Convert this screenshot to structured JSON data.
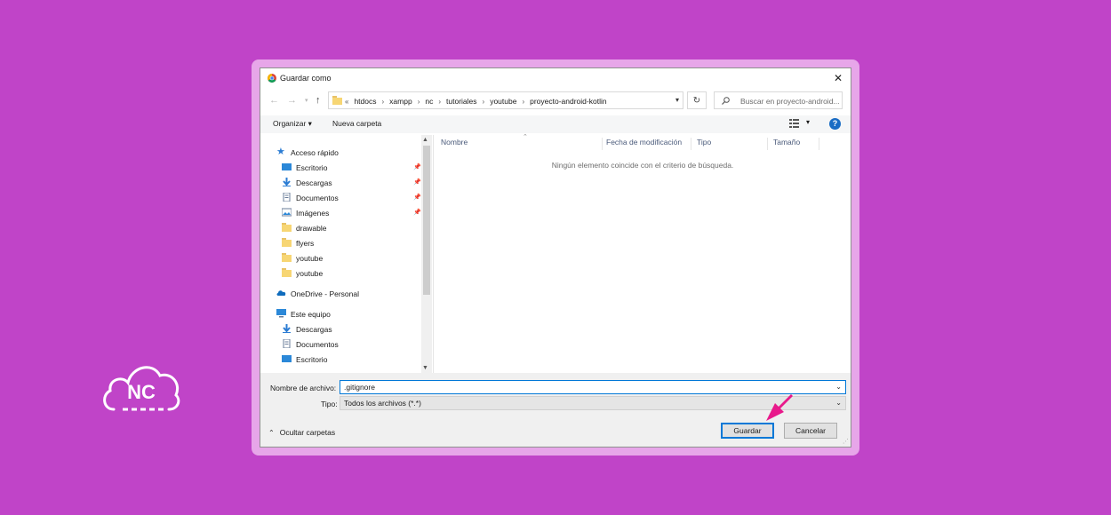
{
  "brand": {
    "logo_text": "NC",
    "background_color": "#c044c8",
    "accent_pink": "#e8198b"
  },
  "dialog": {
    "title": "Guardar como",
    "close_label": "✕",
    "nav": {
      "breadcrumb_prefix": "«",
      "crumbs": [
        "htdocs",
        "xampp",
        "nc",
        "tutoriales",
        "youtube",
        "proyecto-android-kotlin"
      ],
      "search_placeholder": "Buscar en proyecto-android..."
    },
    "toolbar": {
      "organize_label": "Organizar ▾",
      "new_folder_label": "Nueva carpeta",
      "help_label": "?"
    },
    "sidebar": {
      "quick_access": "Acceso rápido",
      "quick_items": [
        {
          "label": "Escritorio",
          "icon": "desktop-icon",
          "pinned": true
        },
        {
          "label": "Descargas",
          "icon": "download-icon",
          "pinned": true
        },
        {
          "label": "Documentos",
          "icon": "documents-icon",
          "pinned": true
        },
        {
          "label": "Imágenes",
          "icon": "pictures-icon",
          "pinned": true
        },
        {
          "label": "drawable",
          "icon": "folder-icon",
          "pinned": false
        },
        {
          "label": "flyers",
          "icon": "folder-icon",
          "pinned": false
        },
        {
          "label": "youtube",
          "icon": "folder-icon",
          "pinned": false
        },
        {
          "label": "youtube",
          "icon": "folder-icon",
          "pinned": false
        }
      ],
      "onedrive": "OneDrive - Personal",
      "this_pc": "Este equipo",
      "pc_items": [
        {
          "label": "Descargas",
          "icon": "download-icon"
        },
        {
          "label": "Documentos",
          "icon": "documents-icon"
        },
        {
          "label": "Escritorio",
          "icon": "desktop-icon"
        }
      ]
    },
    "columns": [
      "Nombre",
      "Fecha de modificación",
      "Tipo",
      "Tamaño"
    ],
    "empty_message": "Ningún elemento coincide con el criterio de búsqueda.",
    "filename_label": "Nombre de archivo:",
    "filename_value": ".gitignore",
    "type_label": "Tipo:",
    "type_value": "Todos los archivos (*.*)",
    "hide_folders_label": "Ocultar carpetas",
    "save_label": "Guardar",
    "cancel_label": "Cancelar"
  }
}
